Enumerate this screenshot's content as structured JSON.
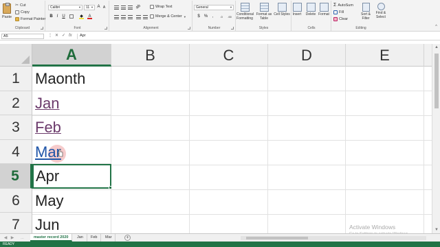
{
  "ribbon": {
    "clipboard": {
      "paste_label": "Paste",
      "cut_label": "Cut",
      "copy_label": "Copy",
      "format_painter_label": "Format Painter",
      "group_label": "Clipboard"
    },
    "font": {
      "font_name": "Calibri",
      "font_size": "11",
      "group_label": "Font"
    },
    "alignment": {
      "wrap_text_label": "Wrap Text",
      "merge_center_label": "Merge & Center",
      "group_label": "Alignment"
    },
    "number": {
      "format_value": "General",
      "group_label": "Number"
    },
    "styles": {
      "conditional_label": "Conditional Formatting",
      "format_as_table_label": "Format as Table",
      "cell_styles_label": "Cell Styles",
      "group_label": "Styles"
    },
    "cells": {
      "insert_label": "Insert",
      "delete_label": "Delete",
      "format_label": "Format",
      "group_label": "Cells"
    },
    "editing": {
      "autosum_label": "AutoSum",
      "fill_label": "Fill",
      "clear_label": "Clear",
      "sort_filter_label": "Sort & Filter",
      "find_select_label": "Find & Select",
      "group_label": "Editing"
    }
  },
  "formula_bar": {
    "name_box": "A5",
    "fx_label": "fx",
    "content": "Apr"
  },
  "grid": {
    "columns": [
      "A",
      "B",
      "C",
      "D",
      "E"
    ],
    "rows": [
      "1",
      "2",
      "3",
      "4",
      "5",
      "6",
      "7"
    ],
    "cells": [
      "Maonth",
      "Jan",
      "Feb",
      "Mar",
      "Apr",
      "May",
      "Jun"
    ]
  },
  "sheet_tabs": [
    "master record 2020",
    "Jan",
    "Feb",
    "Mar"
  ],
  "watermark": {
    "title": "Activate Windows",
    "subtitle": "Go to Settings to activate Windows."
  },
  "status": {
    "text": "READY"
  },
  "colors": {
    "accent": "#217346",
    "visited_link": "#6b3a6b",
    "active_link": "#1f55a8"
  }
}
